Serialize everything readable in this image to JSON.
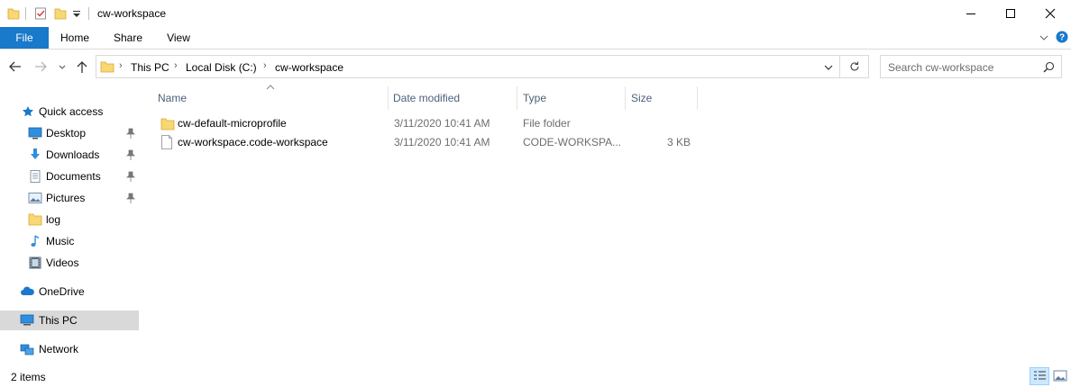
{
  "window": {
    "title": "cw-workspace",
    "controls": [
      "minimize-icon",
      "maximize-icon",
      "close-icon"
    ]
  },
  "ribbon": {
    "tabs": [
      "File",
      "Home",
      "Share",
      "View"
    ],
    "expand_icon": "chevron-down-icon",
    "help_icon": "help-icon"
  },
  "address": {
    "breadcrumb": [
      "This PC",
      "Local Disk (C:)",
      "cw-workspace"
    ]
  },
  "search": {
    "placeholder": "Search cw-workspace"
  },
  "sidebar": {
    "quick_access": "Quick access",
    "pinned": [
      {
        "label": "Desktop",
        "pinned": true,
        "icon": "desktop-icon"
      },
      {
        "label": "Downloads",
        "pinned": true,
        "icon": "download-icon"
      },
      {
        "label": "Documents",
        "pinned": true,
        "icon": "documents-icon"
      },
      {
        "label": "Pictures",
        "pinned": true,
        "icon": "pictures-icon"
      },
      {
        "label": "log",
        "pinned": false,
        "icon": "folder-icon"
      },
      {
        "label": "Music",
        "pinned": false,
        "icon": "music-icon"
      },
      {
        "label": "Videos",
        "pinned": false,
        "icon": "videos-icon"
      }
    ],
    "onedrive": "OneDrive",
    "this_pc": "This PC",
    "network": "Network"
  },
  "columns": [
    "Name",
    "Date modified",
    "Type",
    "Size"
  ],
  "files": [
    {
      "name": "cw-default-microprofile",
      "date": "3/11/2020 10:41 AM",
      "type": "File folder",
      "size": "",
      "icon": "folder-icon"
    },
    {
      "name": "cw-workspace.code-workspace",
      "date": "3/11/2020 10:41 AM",
      "type": "CODE-WORKSPA...",
      "size": "3 KB",
      "icon": "file-icon"
    }
  ],
  "status": {
    "item_count": "2 items"
  },
  "colors": {
    "accent": "#1979ca",
    "selected_nav": "#d9d9d9",
    "folder": "#f8d775"
  }
}
